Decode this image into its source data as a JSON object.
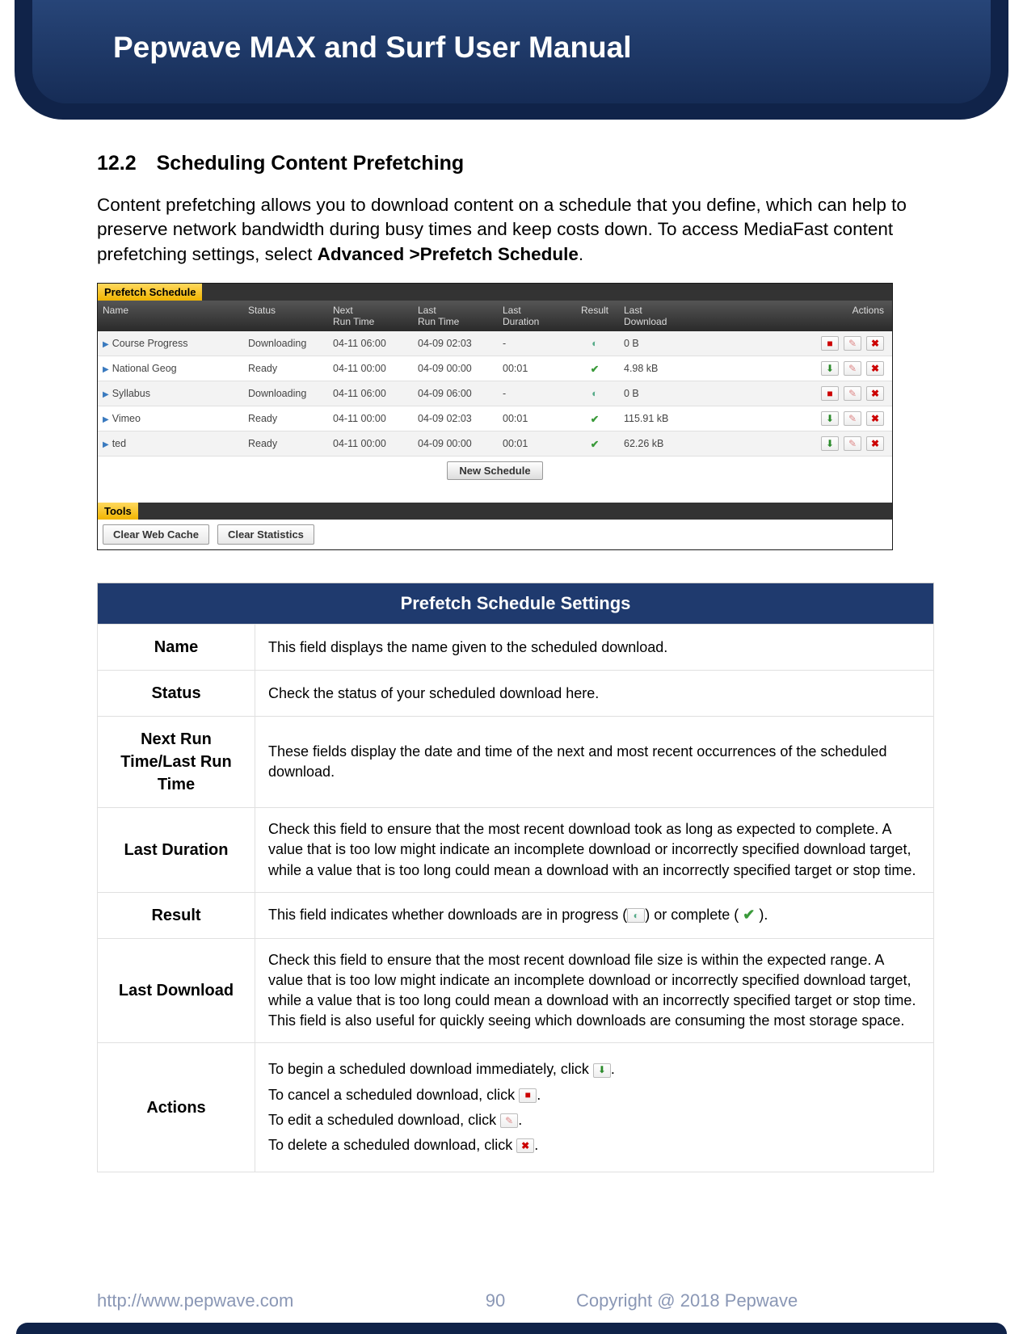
{
  "header": {
    "title": "Pepwave MAX and Surf User Manual"
  },
  "section": {
    "number": "12.2",
    "title": "Scheduling Content Prefetching",
    "intro_a": "Content prefetching allows you to download content on a schedule that you define, which can help to preserve network bandwidth during busy times and keep costs down. To access MediaFast content prefetching settings, select ",
    "intro_b": "Advanced >Prefetch Schedule",
    "intro_c": "."
  },
  "screenshot": {
    "title": "Prefetch Schedule",
    "headers": {
      "name": "Name",
      "status": "Status",
      "next": "Next Run Time",
      "last": "Last Run Time",
      "dur": "Last Duration",
      "res": "Result",
      "dl": "Last Download",
      "act": "Actions"
    },
    "rows": [
      {
        "name": "Course Progress",
        "status": "Downloading",
        "next": "04-11 06:00",
        "last": "04-09 02:03",
        "dur": "-",
        "res": "busy",
        "dl": "0 B",
        "primary": "stop"
      },
      {
        "name": "National Geog",
        "status": "Ready",
        "next": "04-11 00:00",
        "last": "04-09 00:00",
        "dur": "00:01",
        "res": "ok",
        "dl": "4.98 kB",
        "primary": "start"
      },
      {
        "name": "Syllabus",
        "status": "Downloading",
        "next": "04-11 06:00",
        "last": "04-09 06:00",
        "dur": "-",
        "res": "busy",
        "dl": "0 B",
        "primary": "stop"
      },
      {
        "name": "Vimeo",
        "status": "Ready",
        "next": "04-11 00:00",
        "last": "04-09 02:03",
        "dur": "00:01",
        "res": "ok",
        "dl": "115.91 kB",
        "primary": "start"
      },
      {
        "name": "ted",
        "status": "Ready",
        "next": "04-11 00:00",
        "last": "04-09 00:00",
        "dur": "00:01",
        "res": "ok",
        "dl": "62.26 kB",
        "primary": "start"
      }
    ],
    "new_button": "New Schedule",
    "tools_title": "Tools",
    "tool_a": "Clear Web Cache",
    "tool_b": "Clear Statistics"
  },
  "settings": {
    "title": "Prefetch Schedule Settings",
    "rows": {
      "name": {
        "label": "Name",
        "desc": "This field displays the name given to the scheduled download."
      },
      "status": {
        "label": "Status",
        "desc": "Check the status of your scheduled download here."
      },
      "runtime": {
        "label": "Next Run Time/Last Run Time",
        "desc": "These fields display the date and time of the next and most recent occurrences of the scheduled download."
      },
      "lastdur": {
        "label": "Last Duration",
        "desc": "Check this field to ensure that the most recent download took as long as expected to complete. A value that is too low might indicate an incomplete download or incorrectly specified download target, while a value that is too long could mean a download with an incorrectly specified target or stop time."
      },
      "result": {
        "label": "Result",
        "desc_a": "This field indicates whether downloads are in progress (",
        "desc_b": ") or complete ( ",
        "desc_c": " )."
      },
      "lastdl": {
        "label": "Last Download",
        "desc": "Check this field to ensure that the most recent download file size is within the expected range. A value that is too low might indicate an incomplete download or incorrectly specified download target, while a value that is too long could mean a download with an incorrectly specified target or stop time. This field is also useful for quickly seeing which downloads are consuming the most storage space."
      },
      "actions": {
        "label": "Actions",
        "l1": "To begin a scheduled download immediately, click ",
        "l2": "To cancel a scheduled download, click ",
        "l3": "To edit a scheduled download, click ",
        "l4": "To delete a scheduled download, click ",
        "period": "."
      }
    }
  },
  "footer": {
    "url": "http://www.pepwave.com",
    "page": "90",
    "copyright": "Copyright @ 2018 Pepwave"
  }
}
